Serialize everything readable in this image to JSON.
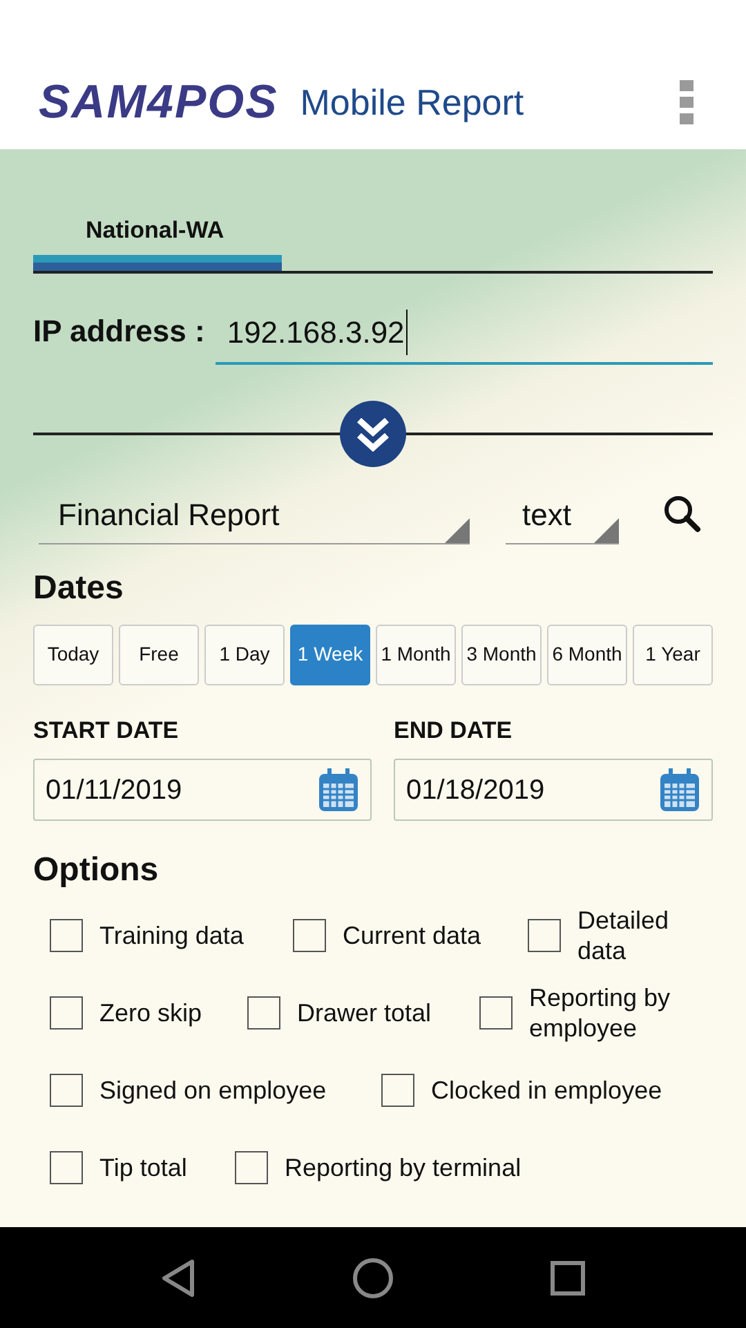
{
  "header": {
    "logo": "SAM4POS",
    "title": "Mobile Report"
  },
  "tabs": [
    {
      "label": "National-WA",
      "selected": true
    }
  ],
  "ip": {
    "label": "IP address :",
    "value": "192.168.3.92"
  },
  "report": {
    "type": "Financial Report",
    "format": "text"
  },
  "dates": {
    "heading": "Dates",
    "ranges": [
      {
        "label": "Today",
        "selected": false
      },
      {
        "label": "Free",
        "selected": false
      },
      {
        "label": "1 Day",
        "selected": false
      },
      {
        "label": "1 Week",
        "selected": true
      },
      {
        "label": "1 Month",
        "selected": false
      },
      {
        "label": "3 Month",
        "selected": false
      },
      {
        "label": "6 Month",
        "selected": false
      },
      {
        "label": "1 Year",
        "selected": false
      }
    ],
    "start": {
      "label": "START DATE",
      "value": "01/11/2019"
    },
    "end": {
      "label": "END DATE",
      "value": "01/18/2019"
    }
  },
  "options": {
    "heading": "Options",
    "rows": [
      [
        {
          "label": "Training data",
          "checked": false
        },
        {
          "label": "Current data",
          "checked": false
        },
        {
          "label": "Detailed data",
          "checked": false
        }
      ],
      [
        {
          "label": "Zero skip",
          "checked": false
        },
        {
          "label": "Drawer total",
          "checked": false
        },
        {
          "label": "Reporting by employee",
          "checked": false
        }
      ],
      [
        {
          "label": "Signed on employee",
          "checked": false
        },
        {
          "label": "Clocked in employee",
          "checked": false
        }
      ],
      [
        {
          "label": "Tip total",
          "checked": false
        },
        {
          "label": "Reporting by terminal",
          "checked": false
        }
      ]
    ]
  }
}
